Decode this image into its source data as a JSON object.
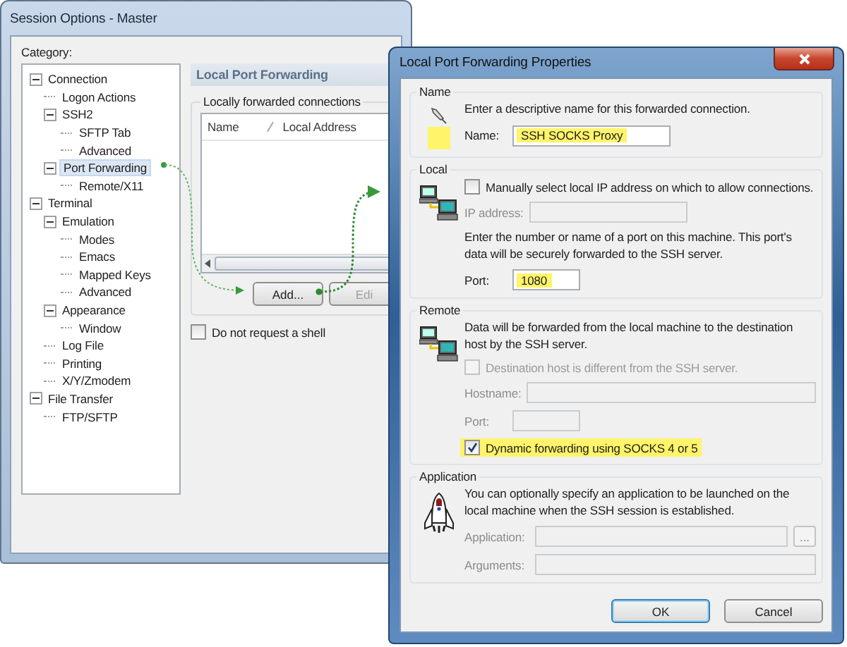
{
  "master_window": {
    "title": "Session Options - Master",
    "category_label": "Category:",
    "tree": [
      {
        "label": "Connection",
        "expanded": true,
        "selected": false,
        "children": [
          {
            "label": "Logon Actions",
            "selected": false
          },
          {
            "label": "SSH2",
            "expanded": true,
            "selected": false,
            "children": [
              {
                "label": "SFTP Tab",
                "selected": false
              },
              {
                "label": "Advanced",
                "selected": false
              }
            ]
          },
          {
            "label": "Port Forwarding",
            "expanded": true,
            "selected": true,
            "children": [
              {
                "label": "Remote/X11",
                "selected": false
              }
            ]
          }
        ]
      },
      {
        "label": "Terminal",
        "expanded": true,
        "selected": false,
        "children": [
          {
            "label": "Emulation",
            "expanded": true,
            "selected": false,
            "children": [
              {
                "label": "Modes",
                "selected": false
              },
              {
                "label": "Emacs",
                "selected": false
              },
              {
                "label": "Mapped Keys",
                "selected": false
              },
              {
                "label": "Advanced",
                "selected": false
              }
            ]
          },
          {
            "label": "Appearance",
            "expanded": true,
            "selected": false,
            "children": [
              {
                "label": "Window",
                "selected": false
              }
            ]
          },
          {
            "label": "Log File",
            "selected": false
          },
          {
            "label": "Printing",
            "selected": false
          },
          {
            "label": "X/Y/Zmodem",
            "selected": false
          }
        ]
      },
      {
        "label": "File Transfer",
        "expanded": true,
        "selected": false,
        "children": [
          {
            "label": "FTP/SFTP",
            "selected": false
          }
        ]
      }
    ],
    "panel": {
      "header": "Local Port Forwarding",
      "group_label": "Locally forwarded connections",
      "columns": [
        "Name",
        "Local Address"
      ],
      "buttons": [
        {
          "label": "Add...",
          "disabled": false
        },
        {
          "label": "Edi",
          "disabled": true
        }
      ],
      "shell_option": {
        "label": "Do not request a shell",
        "checked": false
      }
    }
  },
  "dialog": {
    "title": "Local Port Forwarding Properties",
    "groups": [
      {
        "kind": "name",
        "title": "Name",
        "items": [
          {
            "kind": "text",
            "text": "Enter a descriptive name for this forwarded connection."
          },
          {
            "kind": "medium_field",
            "label": "Name:",
            "value": "SSH SOCKS Proxy",
            "highlighted": true,
            "disabled": false
          }
        ]
      },
      {
        "kind": "local",
        "title": "Local",
        "items": [
          {
            "kind": "checkbox",
            "label": "Manually select local IP address on which to allow connections.",
            "checked": false,
            "disabled": false,
            "highlighted": false
          },
          {
            "kind": "medium_field",
            "label": "IP address:",
            "disabled": true
          },
          {
            "kind": "text",
            "text": "Enter the number or name of a port on this machine.  This port's data will be securely forwarded to the SSH server."
          },
          {
            "kind": "short_field",
            "label": "Port:",
            "value": "1080",
            "highlighted": true,
            "disabled": false
          }
        ]
      },
      {
        "kind": "remote",
        "title": "Remote",
        "items": [
          {
            "kind": "text",
            "text": "Data will be forwarded from the local machine to the destination host by the SSH server."
          },
          {
            "kind": "checkbox",
            "label": "Destination host is different from the SSH server.",
            "checked": false,
            "disabled": true,
            "highlighted": false
          },
          {
            "kind": "wide_field",
            "label": "Hostname:",
            "disabled": true
          },
          {
            "kind": "short_field",
            "label": "Port:",
            "disabled": true
          },
          {
            "kind": "checkbox",
            "label": "Dynamic forwarding using SOCKS 4 or 5",
            "checked": true,
            "disabled": false,
            "highlighted": true
          }
        ]
      },
      {
        "kind": "application",
        "title": "Application",
        "items": [
          {
            "kind": "text",
            "text": "You can optionally specify an application to be launched on the local machine when the SSH session is established."
          },
          {
            "kind": "browse_field",
            "label": "Application:",
            "button": "...",
            "disabled": true
          },
          {
            "kind": "wide_field",
            "label": "Arguments:",
            "disabled": true
          }
        ]
      }
    ],
    "buttons": [
      {
        "label": "OK",
        "default": true
      },
      {
        "label": "Cancel",
        "default": false
      }
    ]
  }
}
